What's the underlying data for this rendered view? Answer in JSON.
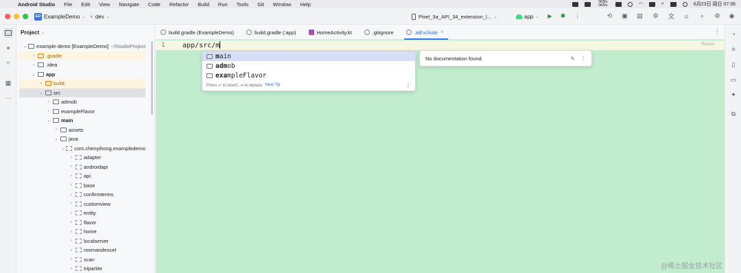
{
  "menubar": {
    "app_name": "Android Studio",
    "items": [
      "File",
      "Edit",
      "View",
      "Navigate",
      "Code",
      "Refactor",
      "Build",
      "Run",
      "Tools",
      "Git",
      "Window",
      "Help"
    ],
    "net_up": "0KB/s",
    "net_down": "0KB/s",
    "datetime": "6月23日 周日  07:36"
  },
  "toolbar": {
    "project_badge": "ED",
    "project_name": "ExampleDemo",
    "branch": "dev",
    "device": "Pixel_3a_API_34_extension_l...",
    "run_config": "app"
  },
  "project_panel": {
    "title": "Project",
    "tree": [
      {
        "name": "example-demo [ExampleDemo]",
        "path": "~/StudioProject",
        "arrow": "down",
        "icon": "folder",
        "bold": false
      },
      {
        "name": ".gradle",
        "arrow": "right",
        "icon": "folder-orange",
        "highlight": true
      },
      {
        "name": ".idea",
        "arrow": "right",
        "icon": "folder"
      },
      {
        "name": "app",
        "arrow": "down",
        "icon": "folder",
        "bold": true
      },
      {
        "name": "build",
        "arrow": "right",
        "icon": "folder-orange",
        "highlight": true
      },
      {
        "name": "src",
        "arrow": "down",
        "icon": "folder",
        "selected": true
      },
      {
        "name": "admob",
        "arrow": "right",
        "icon": "folder"
      },
      {
        "name": "exampleFlavor",
        "arrow": "right",
        "icon": "folder"
      },
      {
        "name": "main",
        "arrow": "down",
        "icon": "folder",
        "bold": true
      },
      {
        "name": "assets",
        "arrow": "right",
        "icon": "folder"
      },
      {
        "name": "java",
        "arrow": "down",
        "icon": "folder"
      },
      {
        "name": "com.chenyihong.exampledemo",
        "arrow": "down",
        "icon": "package"
      },
      {
        "name": "adapter",
        "arrow": "right",
        "icon": "package"
      },
      {
        "name": "androidapi",
        "arrow": "right",
        "icon": "package"
      },
      {
        "name": "api",
        "arrow": "right",
        "icon": "package"
      },
      {
        "name": "base",
        "arrow": "right",
        "icon": "package"
      },
      {
        "name": "confirmterms",
        "arrow": "right",
        "icon": "package"
      },
      {
        "name": "customview",
        "arrow": "right",
        "icon": "package"
      },
      {
        "name": "entity",
        "arrow": "right",
        "icon": "package"
      },
      {
        "name": "flavor",
        "arrow": "right",
        "icon": "package"
      },
      {
        "name": "home",
        "arrow": "right",
        "icon": "package"
      },
      {
        "name": "localserver",
        "arrow": "right",
        "icon": "package"
      },
      {
        "name": "roomandexcel",
        "arrow": "right",
        "icon": "package"
      },
      {
        "name": "scan",
        "arrow": "right",
        "icon": "package"
      },
      {
        "name": "tripartite",
        "arrow": "right",
        "icon": "package"
      }
    ]
  },
  "tabs": [
    {
      "label": "build.gradle (ExampleDemo)",
      "icon": "gradle"
    },
    {
      "label": "build.gradle (:app)",
      "icon": "gradle"
    },
    {
      "label": "HomeActivity.kt",
      "icon": "kotlin"
    },
    {
      "label": ".gitignore",
      "icon": "ignore"
    },
    {
      "label": ".aiExclude",
      "icon": "ignore",
      "active": true,
      "close": "×"
    }
  ],
  "editor": {
    "line_number": "1",
    "code": "app/src/m",
    "reader_mode": "Reader"
  },
  "completion": {
    "items": [
      {
        "prefix": "m",
        "rest": "ain",
        "selected": true
      },
      {
        "prefix": "adm",
        "rest": "ob"
      },
      {
        "prefix": "exa",
        "rest": "mpleFlavor"
      }
    ],
    "footer": "Press ↩ to insert, ⇥ to replace",
    "next_tip": "Next Tip"
  },
  "doc_popup": {
    "text": "No documentation found."
  },
  "watermark": "@稀土掘金技术社区"
}
